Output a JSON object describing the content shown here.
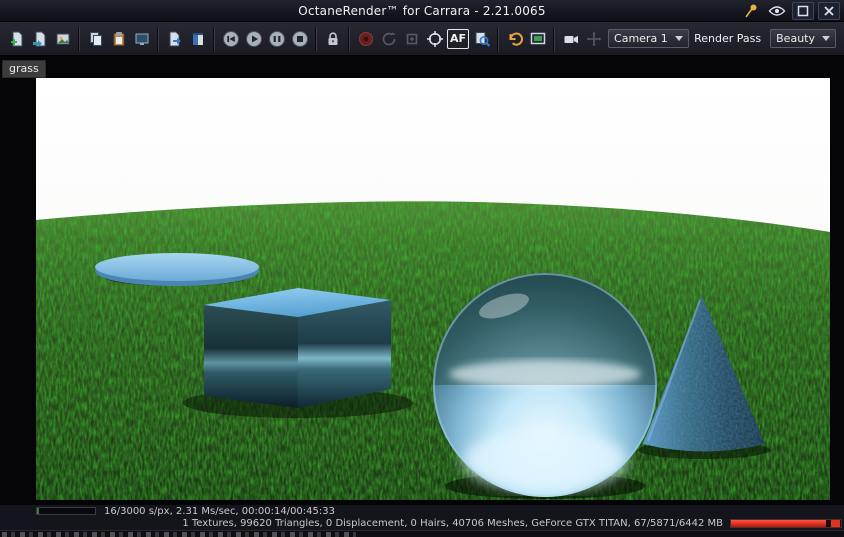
{
  "window": {
    "title": "OctaneRender™ for Carrara - 2.21.0065"
  },
  "viewport": {
    "tab": "grass"
  },
  "toolbar": {
    "af_label": "AF",
    "camera_value": "Camera 1",
    "render_pass_label": "Render Pass",
    "render_pass_value": "Beauty"
  },
  "status": {
    "render_stats": "16/3000 s/px, 2.31 Ms/sec, 00:00:14/00:45:33",
    "scene_stats": "1 Textures, 99620 Triangles, 0 Displacement, 0 Hairs, 40706 Meshes, GeForce GTX TITAN, 67/5871/6442 MB"
  },
  "colors": {
    "accent_blue": "#6fb3dd",
    "grass_green": "#2b4f1c",
    "sky_white": "#ffffff",
    "memory_bar_red": "#d02818",
    "undo_orange": "#e8a33d"
  },
  "icons": {
    "titlebar": [
      "pin-icon",
      "eye-icon",
      "maximize-icon",
      "close-icon"
    ],
    "toolbar": [
      "new-scene-icon",
      "open-scene-icon",
      "save-image-icon",
      "copy-icon",
      "paste-icon",
      "clone-window-icon",
      "export-material-icon",
      "material-library-icon",
      "restart-render-icon",
      "play-render-icon",
      "pause-render-icon",
      "stop-render-icon",
      "lock-resolution-icon",
      "film-settings-icon",
      "refresh-icon",
      "sync-icon",
      "focus-picker-icon",
      "af-toggle",
      "render-region-icon",
      "undo-icon",
      "fullscreen-icon",
      "camera-icon",
      "camera-transform-icon",
      "chevron-down-icon"
    ]
  }
}
